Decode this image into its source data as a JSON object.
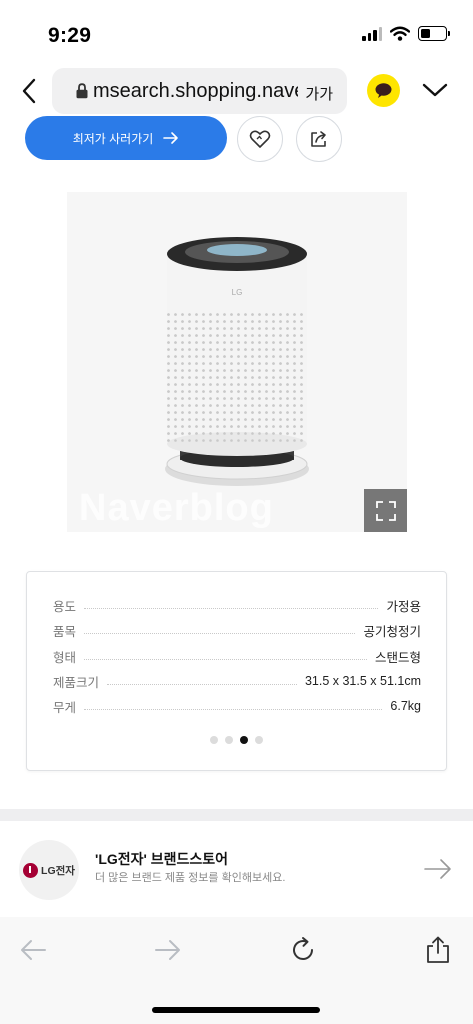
{
  "status_bar": {
    "time": "9:29",
    "icons": [
      "cellular-signal-icon",
      "wifi-icon",
      "battery-icon"
    ]
  },
  "address_bar": {
    "url": "msearch.shopping.naver.com",
    "font_size_label": "가가",
    "icons": [
      "back-chevron-icon",
      "lock-icon",
      "kakaotalk-icon",
      "chevron-down-icon"
    ]
  },
  "actions": {
    "buy_label": "최저가 사러가기",
    "icons": [
      "arrow-right-icon",
      "heart-icon",
      "share-icon"
    ]
  },
  "product_image": {
    "watermark": "Naverblog",
    "icons": [
      "expand-icon"
    ]
  },
  "specs": [
    {
      "label": "용도",
      "value": "가정용"
    },
    {
      "label": "품목",
      "value": "공기청정기"
    },
    {
      "label": "형태",
      "value": "스탠드형"
    },
    {
      "label": "제품크기",
      "value": "31.5 x 31.5 x 51.1cm"
    },
    {
      "label": "무게",
      "value": "6.7kg"
    }
  ],
  "carousel": {
    "count": 4,
    "active_index": 2
  },
  "brand_store": {
    "logo_text": "LG전자",
    "name": "'LG전자' 브랜드스토어",
    "description": "더 많은 브랜드 제품 정보를 확인해보세요.",
    "icons": [
      "arrow-right-icon"
    ]
  },
  "toolbar": {
    "icons": [
      "back-arrow-icon",
      "forward-arrow-icon",
      "reload-icon",
      "share-icon"
    ]
  },
  "colors": {
    "accent_blue": "#2b7be8",
    "kakao_yellow": "#fee500",
    "lg_red": "#a50034"
  }
}
